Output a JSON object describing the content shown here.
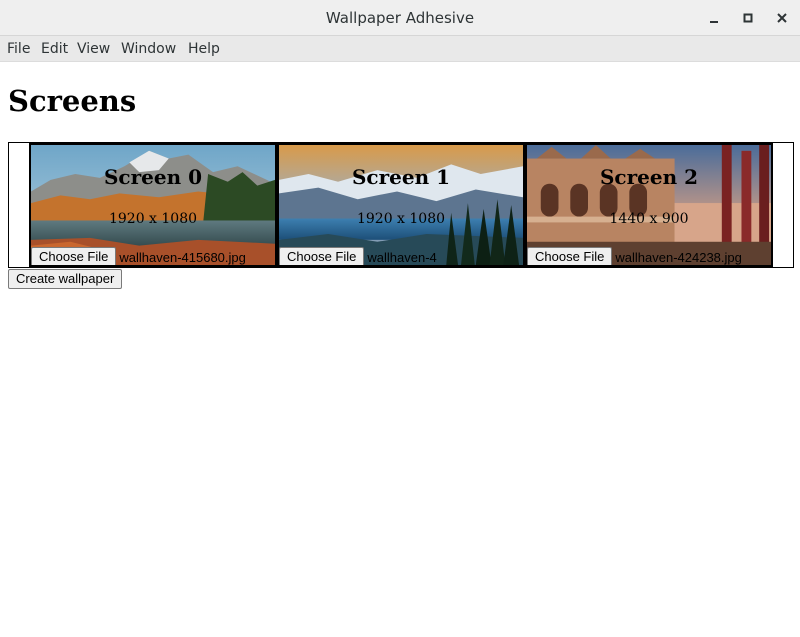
{
  "window": {
    "title": "Wallpaper Adhesive",
    "minimize_icon": "minimize-icon",
    "maximize_icon": "maximize-icon",
    "close_icon": "close-icon"
  },
  "menubar": {
    "items": [
      {
        "label": "File"
      },
      {
        "label": "Edit"
      },
      {
        "label": "View"
      },
      {
        "label": "Window"
      },
      {
        "label": "Help"
      }
    ]
  },
  "page": {
    "heading": "Screens",
    "create_button_label": "Create wallpaper"
  },
  "screens": [
    {
      "title": "Screen 0",
      "resolution": "1920 x 1080",
      "choose_label": "Choose File",
      "file_name": "wallhaven-415680.jpg",
      "thumbnail": "mountain-lake-autumn"
    },
    {
      "title": "Screen 1",
      "resolution": "1920 x 1080",
      "choose_label": "Choose File",
      "file_name": "wallhaven-4",
      "thumbnail": "snowy-mountain-valley"
    },
    {
      "title": "Screen 2",
      "resolution": "1440 x 900",
      "choose_label": "Choose File",
      "file_name": "wallhaven-424238.jpg",
      "thumbnail": "venice-cathedral"
    }
  ]
}
